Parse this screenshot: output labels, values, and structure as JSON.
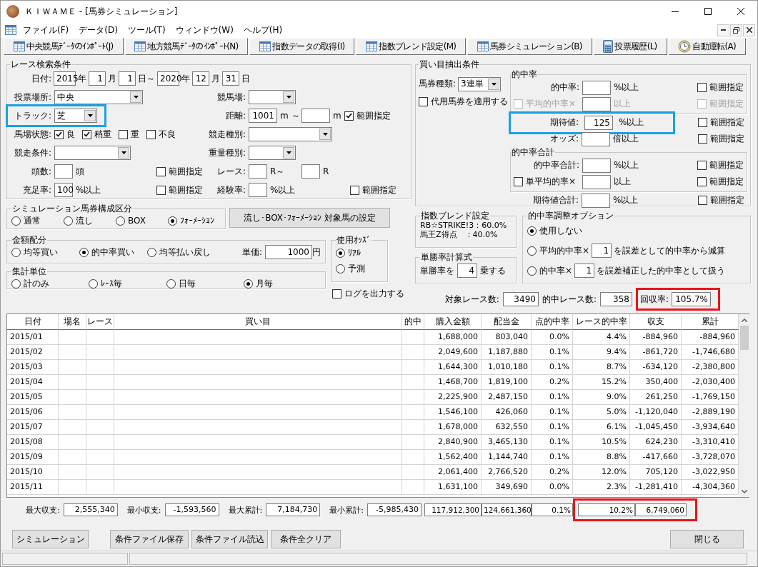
{
  "window": {
    "title": "ＫＩＷＡＭＥ - [馬券シミュレーション]"
  },
  "menu": [
    "ファイル(F)",
    "データ(D)",
    "ツール(T)",
    "ウィンドウ(W)",
    "ヘルプ(H)"
  ],
  "toolbar": [
    "中央競馬ﾃﾞｰﾀのｲﾝﾎﾟｰﾄ(J)",
    "地方競馬ﾃﾞｰﾀのｲﾝﾎﾟｰﾄ(N)",
    "指数データの取得(I)",
    "指数ブレンド設定(M)",
    "馬券シミュレーション(B)",
    "投票履歴(L)",
    "自動運転(A)"
  ],
  "race_search": {
    "title": "レース検索条件",
    "date": {
      "label": "日付:",
      "parts": [
        {
          "value": "2015",
          "unit": "年"
        },
        {
          "value": "1",
          "unit": "月"
        },
        {
          "value": "1",
          "unit": "日～"
        },
        {
          "value": "2020",
          "unit": "年"
        },
        {
          "value": "12",
          "unit": "月"
        },
        {
          "value": "31",
          "unit": "日"
        }
      ]
    },
    "venue": {
      "label": "投票場所:",
      "value": "中央"
    },
    "racecourse": {
      "label": "競馬場:"
    },
    "track": {
      "label": "トラック:",
      "value": "芝",
      "highlighted": true
    },
    "distance": {
      "label": "距離:",
      "from": "1001",
      "from_unit": "m ～",
      "to_unit": "m",
      "range": {
        "label": "範囲指定",
        "checked": true
      }
    },
    "going": {
      "label": "馬場状態:",
      "options": [
        {
          "label": "良",
          "checked": true
        },
        {
          "label": "稍重",
          "checked": true
        },
        {
          "label": "重",
          "checked": false
        },
        {
          "label": "不良",
          "checked": false
        }
      ]
    },
    "race_class": {
      "label": "競走種別:"
    },
    "race_condition": {
      "label": "競走条件:"
    },
    "weight_type": {
      "label": "重量種別:"
    },
    "runners": {
      "label": "頭数:",
      "unit": "頭",
      "range": {
        "label": "範囲指定",
        "checked": false
      }
    },
    "race_number": {
      "label": "レース:",
      "from_unit": "R～",
      "to_unit": "R"
    },
    "fill_rate": {
      "label": "充足率:",
      "value": "100",
      "unit": "%以上",
      "range": {
        "label": "範囲指定",
        "checked": false
      }
    },
    "experience_rate": {
      "label": "経験率:",
      "unit": "%以上",
      "range": {
        "label": "範囲指定",
        "checked": false
      }
    }
  },
  "bet_conditions": {
    "title": "買い目抽出条件",
    "bet_type": {
      "label": "馬券種類:",
      "value": "3連単"
    },
    "substitute": {
      "label": "代用馬券を適用する",
      "checked": false
    },
    "rows": [
      {
        "kind": "group",
        "title": "的中率",
        "rows": [
          {
            "kind": "field",
            "label": "的中率:",
            "unit": "%以上",
            "range": {
              "label": "範囲指定",
              "checked": false,
              "disabled": false
            }
          },
          {
            "kind": "check_field",
            "label": "平均的中率×",
            "checked": false,
            "disabled": true,
            "unit": "以上",
            "range": {
              "label": "範囲指定",
              "checked": false,
              "disabled": true
            }
          }
        ]
      },
      {
        "kind": "field",
        "label": "期待値:",
        "value": "125",
        "unit": "%以上",
        "highlighted": true,
        "range": {
          "label": "範囲指定",
          "checked": false,
          "disabled": false
        }
      },
      {
        "kind": "field",
        "label": "オッズ:",
        "unit": "倍以上",
        "range": {
          "label": "範囲指定",
          "checked": false,
          "disabled": false
        }
      },
      {
        "kind": "group",
        "title": "的中率合計",
        "rows": [
          {
            "kind": "field",
            "label": "的中率合計:",
            "unit": "%以上",
            "range": {
              "label": "範囲指定",
              "checked": false,
              "disabled": false
            }
          },
          {
            "kind": "check_field",
            "label": "単平均的率×",
            "checked": false,
            "disabled": false,
            "unit": "以上",
            "range": {
              "label": "範囲指定",
              "checked": false,
              "disabled": false
            }
          }
        ]
      },
      {
        "kind": "field",
        "label": "期待値合計:",
        "unit": "%以上",
        "range": {
          "label": "範囲指定",
          "checked": false,
          "disabled": false
        }
      }
    ]
  },
  "sim_type": {
    "title": "シミュレーション馬券構成区分",
    "options": [
      {
        "label": "通常",
        "selected": false
      },
      {
        "label": "流し",
        "selected": false
      },
      {
        "label": "BOX",
        "selected": false
      },
      {
        "label": "ﾌｫｰﾒｰｼｮﾝ",
        "selected": true
      }
    ]
  },
  "setup_button": "流し･BOX･ﾌｫｰﾒｰｼｮﾝ  対象馬の設定",
  "amount": {
    "title": "金額配分",
    "options": [
      {
        "label": "均等買い",
        "selected": false
      },
      {
        "label": "的中率買い",
        "selected": true
      },
      {
        "label": "均等払い戻し",
        "selected": false
      }
    ],
    "unit_price": {
      "label": "単価:",
      "value": "1000",
      "unit": "円"
    }
  },
  "odds": {
    "title": "使用ｵｯｽﾞ",
    "options": [
      {
        "label": "ﾘｱﾙ",
        "selected": true
      },
      {
        "label": "予測",
        "selected": false
      }
    ]
  },
  "aggregate": {
    "title": "集計単位",
    "options": [
      {
        "label": "計のみ",
        "selected": false
      },
      {
        "label": "ﾚｰｽ毎",
        "selected": false
      },
      {
        "label": "日毎",
        "selected": false
      },
      {
        "label": "月毎",
        "selected": true
      }
    ]
  },
  "log": {
    "label": "ログを出力する",
    "checked": false
  },
  "blend": {
    "title": "指数ブレンド設定",
    "lines": [
      "RB☆STRIKE!3：60.0%",
      "馬王Z得点　：40.0%"
    ]
  },
  "win_formula": {
    "title": "単勝率計算式",
    "prefix": "単勝率を",
    "value": "4",
    "suffix": "乗する"
  },
  "adjust": {
    "title": "的中率調整オプション",
    "options": [
      {
        "label": "使用しない",
        "selected": true
      },
      {
        "label": "平均的中率×",
        "value": "1",
        "suffix": "を誤差として的中率から減算",
        "selected": false
      },
      {
        "label": "的中率×",
        "value": "1",
        "suffix": "を誤差補正した的中率として扱う",
        "selected": false
      }
    ]
  },
  "counts": [
    {
      "label": "対象レース数:",
      "value": "3490"
    },
    {
      "label": "的中レース数:",
      "value": "358"
    }
  ],
  "highlighted_count": {
    "label": "回収率:",
    "value": "105.7%"
  },
  "table": {
    "columns": [
      "日付",
      "場名",
      "レース",
      "買い目",
      "的中",
      "購入金額",
      "配当金",
      "点的中率",
      "レース的中率",
      "収支",
      "累計"
    ],
    "rows": [
      {
        "date": "2015/01",
        "values": [
          "1,688,000",
          "803,040",
          "0.0%",
          "4.4%",
          "-884,960",
          "-884,960"
        ]
      },
      {
        "date": "2015/02",
        "values": [
          "2,049,600",
          "1,187,880",
          "0.1%",
          "9.4%",
          "-861,720",
          "-1,746,680"
        ]
      },
      {
        "date": "2015/03",
        "values": [
          "1,644,300",
          "1,010,180",
          "0.1%",
          "8.7%",
          "-634,120",
          "-2,380,800"
        ]
      },
      {
        "date": "2015/04",
        "values": [
          "1,468,700",
          "1,819,100",
          "0.2%",
          "15.2%",
          "350,400",
          "-2,030,400"
        ]
      },
      {
        "date": "2015/05",
        "values": [
          "2,225,900",
          "2,487,150",
          "0.1%",
          "9.0%",
          "261,250",
          "-1,769,150"
        ]
      },
      {
        "date": "2015/06",
        "values": [
          "1,546,100",
          "426,060",
          "0.1%",
          "5.0%",
          "-1,120,040",
          "-2,889,190"
        ]
      },
      {
        "date": "2015/07",
        "values": [
          "1,678,000",
          "632,550",
          "0.1%",
          "6.1%",
          "-1,045,450",
          "-3,934,640"
        ]
      },
      {
        "date": "2015/08",
        "values": [
          "2,840,900",
          "3,465,130",
          "0.1%",
          "10.5%",
          "624,230",
          "-3,310,410"
        ]
      },
      {
        "date": "2015/09",
        "values": [
          "1,562,400",
          "1,144,740",
          "0.1%",
          "8.8%",
          "-417,660",
          "-3,728,070"
        ]
      },
      {
        "date": "2015/10",
        "values": [
          "2,061,400",
          "2,766,520",
          "0.2%",
          "12.0%",
          "705,120",
          "-3,022,950"
        ]
      },
      {
        "date": "2015/11",
        "values": [
          "1,631,100",
          "349,690",
          "0.0%",
          "2.3%",
          "-1,281,410",
          "-4,304,360"
        ]
      }
    ]
  },
  "summary": {
    "stats": [
      {
        "label": "最大収支:",
        "value": "2,555,340"
      },
      {
        "label": "最小収支:",
        "value": "-1,593,560"
      },
      {
        "label": "最大累計:",
        "value": "7,184,730"
      },
      {
        "label": "最小累計:",
        "value": "-5,985,430"
      }
    ],
    "totals": [
      "117,912,300",
      "124,661,360",
      "0.1%"
    ],
    "highlighted_totals": [
      "10.2%",
      "6,749,060"
    ]
  },
  "buttons": [
    "シミュレーション",
    "条件ファイル保存",
    "条件ファイル読込",
    "条件全クリア"
  ],
  "close_button": "閉じる"
}
